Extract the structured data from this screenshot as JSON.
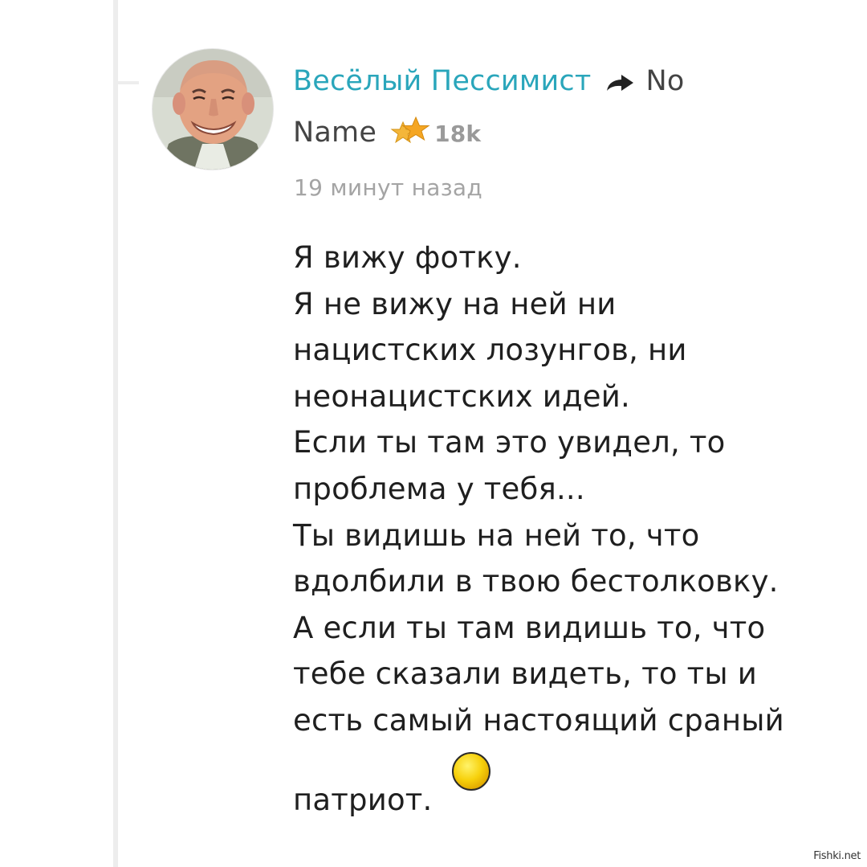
{
  "comment": {
    "author": "Весёлый Пессимист",
    "reply_to_line1": "No",
    "reply_to_line2": "Name",
    "karma": "18k",
    "timestamp": "19 минут назад",
    "lines": [
      "Я вижу фотку.",
      "Я не вижу на ней ни",
      "нацистских лозунгов, ни",
      "неонацистских идей.",
      "Если ты там это увидел, то",
      "проблема у тебя...",
      "Ты видишь на ней то, что",
      "вдолбили в твою бестолковку.",
      "А если ты там видишь то, что",
      "тебе сказали видеть, то ты и",
      "есть самый настоящий сраный",
      "патриот."
    ]
  },
  "watermark": "Fishki.net",
  "colors": {
    "author": "#2aa6bb",
    "text": "#1f1f1f",
    "muted": "#a4a4a4",
    "star": "#f5a623",
    "thread_line": "#ededed"
  },
  "icons": {
    "reply": "reply-arrow-icon",
    "rating": "star-icon",
    "emoji": "yellow-circle-emoji"
  }
}
